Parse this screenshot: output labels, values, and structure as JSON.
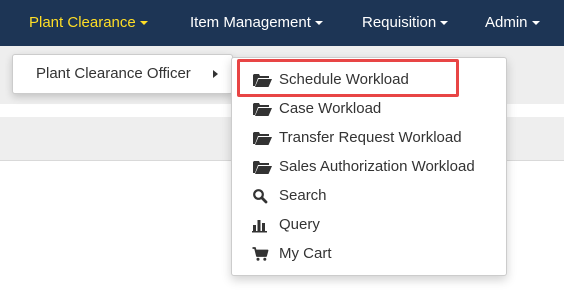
{
  "navbar": {
    "items": [
      {
        "label": "Plant Clearance",
        "active": true
      },
      {
        "label": "Item Management"
      },
      {
        "label": "Requisition"
      },
      {
        "label": "Admin"
      }
    ],
    "background": "#1d3555",
    "active_color": "#ffde26"
  },
  "dropdown": {
    "label": "Plant Clearance Officer"
  },
  "submenu": {
    "items": [
      {
        "label": "Schedule Workload",
        "icon": "folder-open-icon",
        "highlighted": true
      },
      {
        "label": "Case Workload",
        "icon": "folder-open-icon"
      },
      {
        "label": "Transfer Request Workload",
        "icon": "folder-open-icon"
      },
      {
        "label": "Sales Authorization Workload",
        "icon": "folder-open-icon"
      },
      {
        "label": "Search",
        "icon": "search-icon"
      },
      {
        "label": "Query",
        "icon": "bar-chart-icon"
      },
      {
        "label": "My Cart",
        "icon": "cart-icon"
      }
    ],
    "highlight_color": "#e84545"
  }
}
